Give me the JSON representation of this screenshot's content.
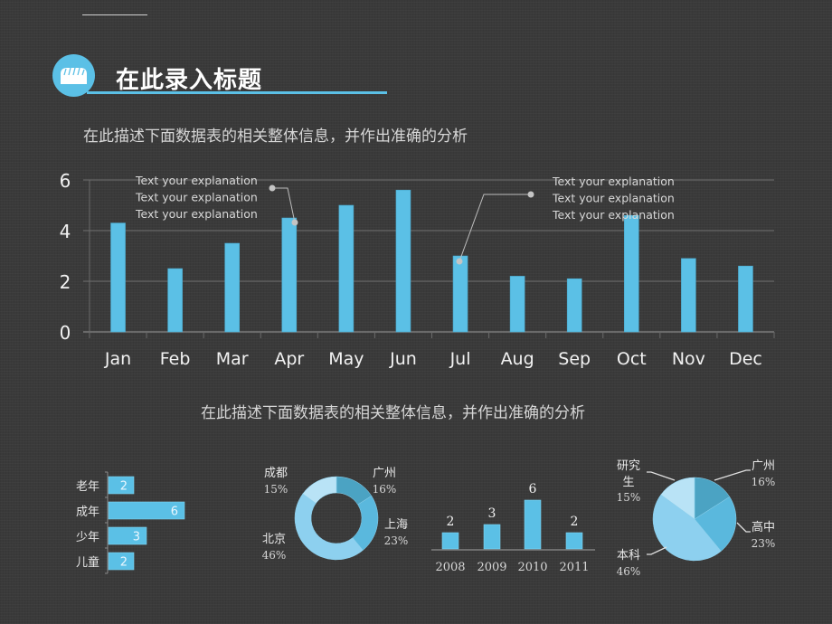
{
  "header": {
    "title": "在此录入标题",
    "icon": "bread-icon",
    "description_top": "在此描述下面数据表的相关整体信息，并作出准确的分析",
    "description_bottom": "在此描述下面数据表的相关整体信息，并作出准确的分析"
  },
  "colors": {
    "accent": "#5bc0e6",
    "background": "#3a3a3a",
    "pie_dark": "#4ba3c3",
    "pie_mid": "#5ab8dd",
    "pie_light": "#8dd0ef",
    "pie_pale": "#b9e3f6"
  },
  "annotations": [
    {
      "lines": [
        "Text your explanation",
        "Text your explanation",
        "Text your explanation"
      ],
      "target": "Apr"
    },
    {
      "lines": [
        "Text your explanation",
        "Text your explanation",
        "Text your explanation"
      ],
      "target": "Jul"
    }
  ],
  "chart_data": [
    {
      "type": "bar",
      "title": "",
      "categories": [
        "Jan",
        "Feb",
        "Mar",
        "Apr",
        "May",
        "Jun",
        "Jul",
        "Aug",
        "Sep",
        "Oct",
        "Nov",
        "Dec"
      ],
      "values": [
        4.3,
        2.5,
        3.5,
        4.5,
        5.0,
        5.6,
        3.0,
        2.2,
        2.1,
        4.6,
        2.9,
        2.6
      ],
      "xlabel": "",
      "ylabel": "",
      "ylim": [
        0,
        6
      ],
      "yticks": [
        0,
        2,
        4,
        6
      ],
      "grid": true,
      "legend": "none"
    },
    {
      "type": "bar",
      "orientation": "horizontal",
      "categories": [
        "老年",
        "成年",
        "少年",
        "儿童"
      ],
      "values": [
        2,
        6,
        3,
        2
      ],
      "data_labels": true
    },
    {
      "type": "pie",
      "variant": "donut",
      "slices": [
        {
          "label": "广州",
          "value": 16,
          "pct": "16%"
        },
        {
          "label": "上海",
          "value": 23,
          "pct": "23%"
        },
        {
          "label": "北京",
          "value": 46,
          "pct": "46%"
        },
        {
          "label": "成都",
          "value": 15,
          "pct": "15%"
        }
      ]
    },
    {
      "type": "bar",
      "categories": [
        "2008",
        "2009",
        "2010",
        "2011"
      ],
      "values": [
        2,
        3,
        6,
        2
      ],
      "data_labels": true
    },
    {
      "type": "pie",
      "slices": [
        {
          "label": "广州",
          "value": 16,
          "pct": "16%"
        },
        {
          "label": "高中",
          "value": 23,
          "pct": "23%"
        },
        {
          "label": "本科",
          "value": 46,
          "pct": "46%"
        },
        {
          "label": "研究生",
          "label_lines": [
            "研究",
            "生"
          ],
          "value": 15,
          "pct": "15%"
        }
      ]
    }
  ]
}
